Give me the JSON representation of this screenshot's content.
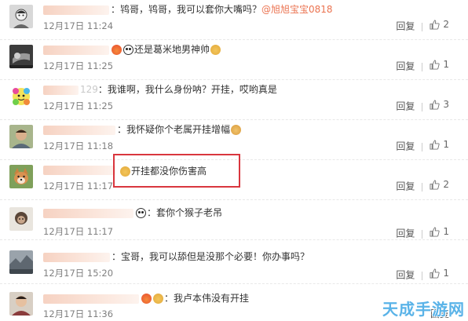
{
  "actions": {
    "reply_label": "回复"
  },
  "comments": [
    {
      "text": "：鸨哥，鸨哥，我可以套你大嘴吗？",
      "mention": "@旭旭宝宝0818",
      "time": "12月17日 11:24",
      "likes": "2"
    },
    {
      "text": "还是葛米地男神帅",
      "time": "12月17日 11:25",
      "likes": "1"
    },
    {
      "name_fragment": "129",
      "text": "：我谁啊，我什么身份呐？开挂，哎哟真是",
      "time": "12月17日 11:25",
      "likes": "3"
    },
    {
      "text": "：我怀疑你个老属开挂增幅",
      "time": "12月17日 11:18",
      "likes": "1"
    },
    {
      "text": "开挂都没你伤害高",
      "time": "12月17日 11:17",
      "likes": "2"
    },
    {
      "text": "：套你个猴子老吊",
      "time": "12月17日 11:17",
      "likes": "1"
    },
    {
      "text": "：宝哥，我可以舔但是没那个必要！你办事吗？",
      "time": "12月17日 15:20",
      "likes": "1"
    },
    {
      "text": "：我卢本伟没有开挂",
      "time": "12月17日 11:36",
      "likes": ""
    }
  ],
  "watermark": {
    "text": "天成手游网"
  }
}
